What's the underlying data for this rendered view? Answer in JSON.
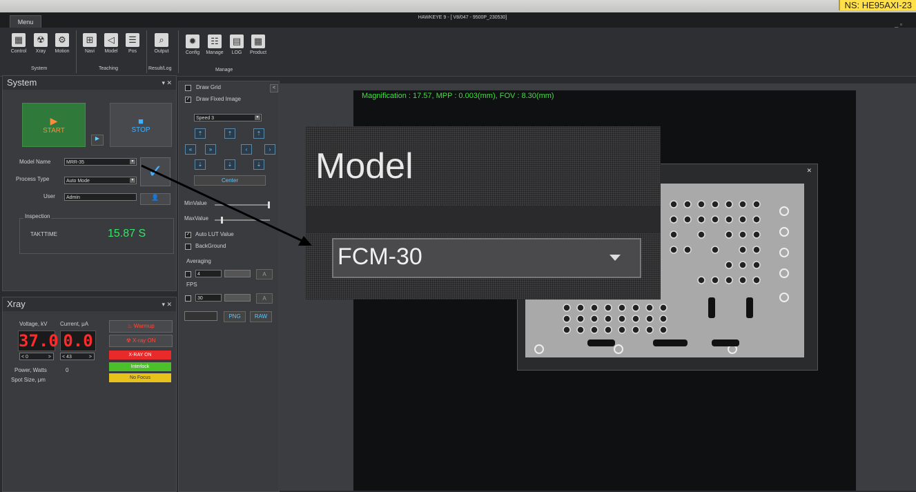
{
  "serial": "NS: HE95AXI-23",
  "window": {
    "title": "HAWKEYE 9 - [ V8/047 - 9500P_230530]",
    "menu_tab": "Menu",
    "controls": "_ ▫"
  },
  "ribbon": {
    "buttons": [
      {
        "label": "Control",
        "icon": "control-icon"
      },
      {
        "label": "Xray",
        "icon": "radiation-icon"
      },
      {
        "label": "Motion",
        "icon": "motion-icon"
      },
      {
        "label": "Navi",
        "icon": "navi-icon"
      },
      {
        "label": "Model",
        "icon": "model-icon"
      },
      {
        "label": "Pos",
        "icon": "pos-icon"
      },
      {
        "label": "Output",
        "icon": "output-icon"
      },
      {
        "label": "Config",
        "icon": "gear-icon"
      },
      {
        "label": "Manage",
        "icon": "manage-icon"
      },
      {
        "label": "LOG",
        "icon": "log-icon"
      },
      {
        "label": "Product",
        "icon": "product-icon"
      }
    ],
    "groups": [
      "System",
      "Teaching",
      "Result/Log",
      "Manage"
    ]
  },
  "system": {
    "title": "System",
    "start_label": "START",
    "stop_label": "STOP",
    "model_name_label": "Model Name",
    "model_name_value": "MRR-35",
    "process_type_label": "Process Type",
    "process_type_value": "Auto Mode",
    "user_label": "User",
    "user_value": "Admin",
    "inspection_label": "Inspection",
    "takttime_label": "TAKTTIME",
    "takttime_value": "15.87 S",
    "colors": {
      "start": "#2f7a3a",
      "takt": "#39e26a"
    }
  },
  "xray": {
    "title": "Xray",
    "voltage_label": "Voltage, kV",
    "current_label": "Current, μA",
    "voltage_value": "37.0",
    "current_value": "0.0",
    "voltage_step": "0",
    "current_step": "43",
    "warmup_label": "Warmup",
    "xray_on_btn": "X-ray ON",
    "status_xray_on": "X-RAY ON",
    "status_interlock": "Interlock",
    "status_nofocus": "No Focus",
    "power_label": "Power, Watts",
    "power_value": "0",
    "spot_label": "Spot Size, μm",
    "colors": {
      "xray_on": "#e82a2a",
      "interlock": "#4bc02b",
      "nofocus": "#e8c21a"
    }
  },
  "controls": {
    "draw_grid": "Draw Grid",
    "draw_fixed_image": "Draw Fixed Image",
    "speed": "Speed 3",
    "center": "Center",
    "min_value": "MinValue",
    "max_value": "MaxValue",
    "auto_lut": "Auto LUT Value",
    "background": "BackGround",
    "averaging": "Averaging",
    "averaging_value": "4",
    "fps": "FPS",
    "fps_value": "30",
    "png": "PNG",
    "raw": "RAW",
    "avg_btn": "A",
    "fps_btn": "A"
  },
  "viewer": {
    "magnification": "Magnification : 17.57, MPP : 0.003(mm), FOV : 8.30(mm)"
  },
  "zoom_inset": {
    "title": "Model",
    "value": "FCM-30"
  }
}
